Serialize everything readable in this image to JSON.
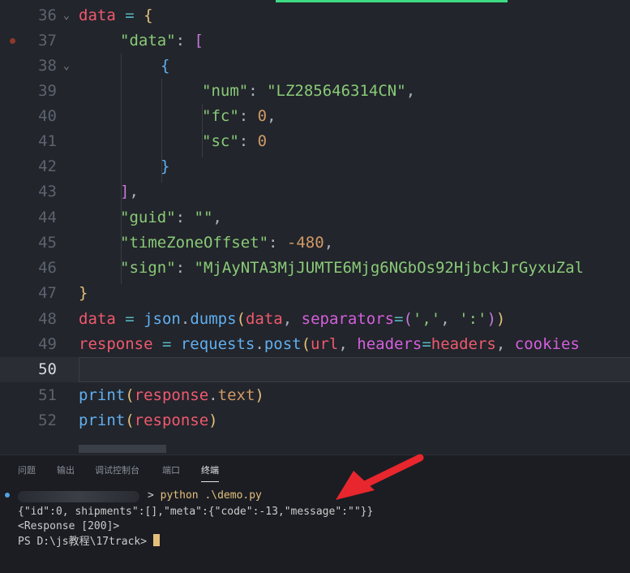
{
  "editor": {
    "lines": [
      {
        "n": "36"
      },
      {
        "n": "37"
      },
      {
        "n": "38"
      },
      {
        "n": "39"
      },
      {
        "n": "40"
      },
      {
        "n": "41"
      },
      {
        "n": "42"
      },
      {
        "n": "43"
      },
      {
        "n": "44"
      },
      {
        "n": "45"
      },
      {
        "n": "46"
      },
      {
        "n": "47"
      },
      {
        "n": "48"
      },
      {
        "n": "49"
      },
      {
        "n": "50"
      },
      {
        "n": "51"
      },
      {
        "n": "52"
      }
    ],
    "code": {
      "l36": {
        "a": "data",
        "b": " = ",
        "c": "{"
      },
      "l37": {
        "a": "\"data\"",
        "b": ": ",
        "c": "["
      },
      "l38": {
        "a": "{"
      },
      "l39": {
        "a": "\"num\"",
        "b": ": ",
        "c": "\"LZ285646314CN\"",
        "d": ","
      },
      "l40": {
        "a": "\"fc\"",
        "b": ": ",
        "c": "0",
        "d": ","
      },
      "l41": {
        "a": "\"sc\"",
        "b": ": ",
        "c": "0"
      },
      "l42": {
        "a": "}"
      },
      "l43": {
        "a": "]",
        "b": ","
      },
      "l44": {
        "a": "\"guid\"",
        "b": ": ",
        "c": "\"\"",
        "d": ","
      },
      "l45": {
        "a": "\"timeZoneOffset\"",
        "b": ": ",
        "c": "-480",
        "d": ","
      },
      "l46": {
        "a": "\"sign\"",
        "b": ": ",
        "c": "\"MjAyNTA3MjJUMTE6Mjg6NGbOs92HjbckJrGyxuZal"
      },
      "l47": {
        "a": "}"
      },
      "l48": {
        "a": "data",
        "b": " = ",
        "c": "json",
        "d": ".",
        "e": "dumps",
        "f": "(",
        "g": "data",
        "h": ", ",
        "i": "separators",
        "j": "=",
        "k": "(",
        "l": "','",
        "m": ", ",
        "n": "':'",
        "o": ")",
        "p": ")"
      },
      "l49": {
        "a": "response",
        "b": " = ",
        "c": "requests",
        "d": ".",
        "e": "post",
        "f": "(",
        "g": "url",
        "h": ", ",
        "i": "headers",
        "j": "=",
        "k": "headers",
        "l": ", ",
        "m": "cookies"
      },
      "l51": {
        "a": "print",
        "b": "(",
        "c": "response",
        "d": ".",
        "e": "text",
        "f": ")"
      },
      "l52": {
        "a": "print",
        "b": "(",
        "c": "response",
        "d": ")"
      }
    }
  },
  "panel": {
    "tabs": [
      "问题",
      "输出",
      "调试控制台",
      "端口",
      "终端"
    ],
    "active_tab": "终端",
    "terminal": {
      "line1_cmd": "python .\\demo.py",
      "line1_prompt_tail": "> ",
      "line2": "{\"id\":0, shipments\":[],\"meta\":{\"code\":-13,\"message\":\"\"}}",
      "line3": "<Response [200]>",
      "line4": "PS D:\\js教程\\17track> "
    }
  },
  "colors": {
    "variable": "#ef596f",
    "string": "#89ca78",
    "number": "#d19a66",
    "function": "#61afef",
    "arrow": "#e8262d"
  }
}
